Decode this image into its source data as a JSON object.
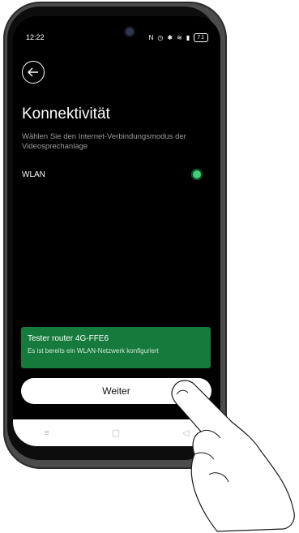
{
  "status_bar": {
    "time": "12:22",
    "icons": [
      "nfc-icon",
      "alarm-icon",
      "bluetooth-icon",
      "wifi-icon",
      "signal-icon",
      "battery-icon"
    ],
    "battery": "71"
  },
  "page": {
    "title": "Konnektivität",
    "subtitle": "Wählen Sie den Internet-Verbindungsmodus der Videosprechanlage"
  },
  "option": {
    "label": "WLAN",
    "selected": true,
    "color": "#3fcf7a"
  },
  "notice": {
    "title": "Tester router 4G-FFE6",
    "text": "Es ist bereits ein WLAN-Netzwerk konfiguriert",
    "color": "#157a3c"
  },
  "next_button": {
    "label": "Weiter"
  },
  "nav_bar": {
    "recents": "≡",
    "home": "▢",
    "back": "◁"
  }
}
